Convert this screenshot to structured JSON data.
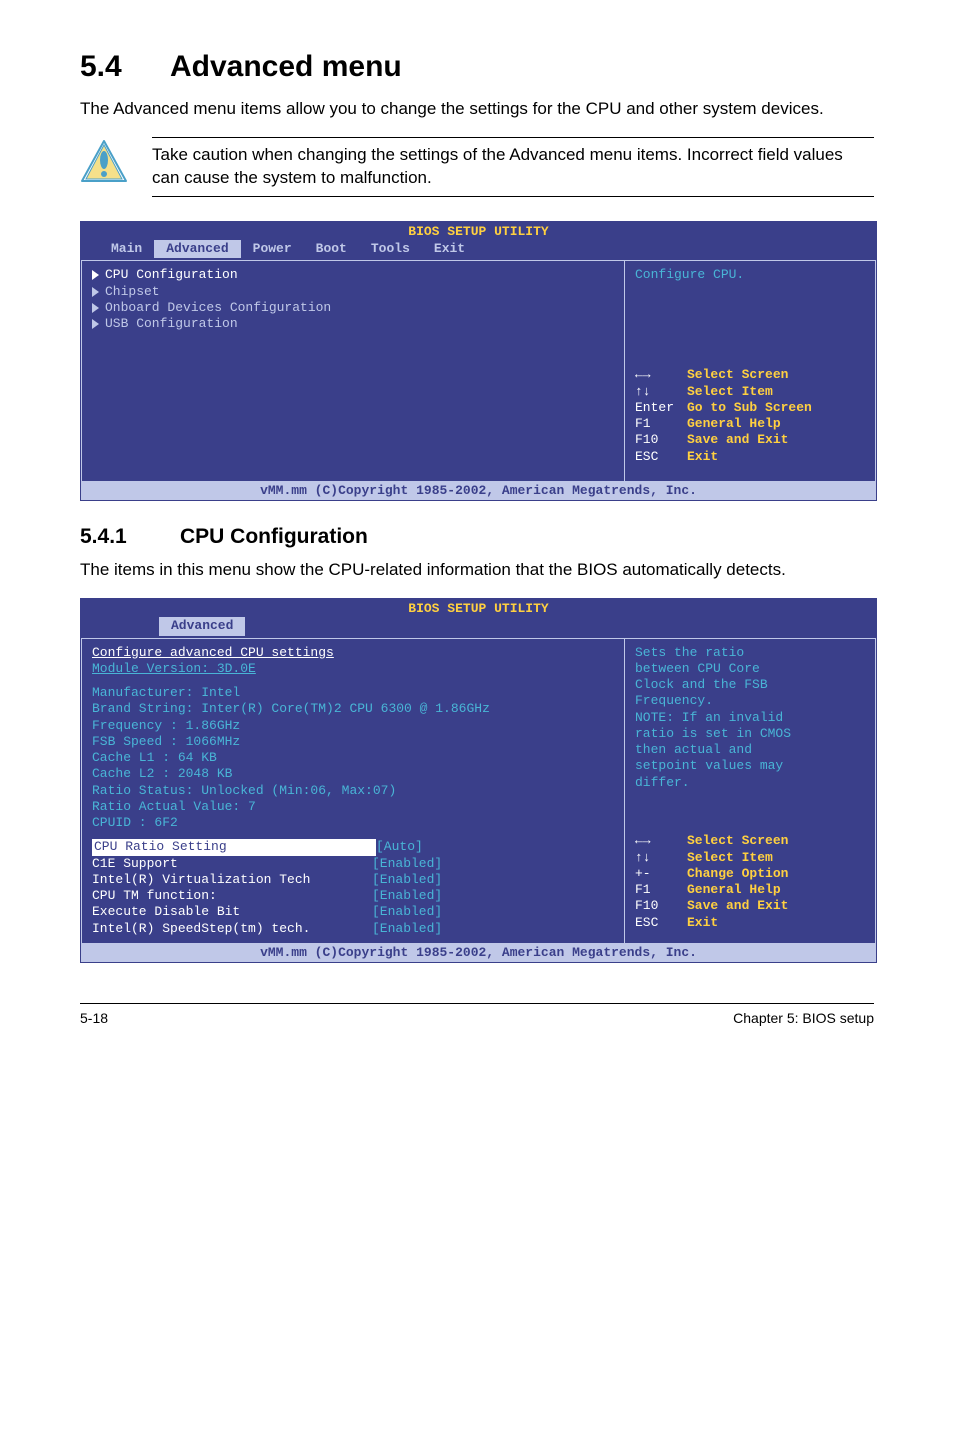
{
  "section": {
    "number": "5.4",
    "title": "Advanced menu",
    "intro": "The Advanced menu items allow you to change the settings for the CPU and other system devices.",
    "note": "Take caution when changing the settings of the Advanced menu items. Incorrect field values can cause the system to malfunction."
  },
  "bios1": {
    "title": "BIOS SETUP UTILITY",
    "tabs": [
      "Main",
      "Advanced",
      "Power",
      "Boot",
      "Tools",
      "Exit"
    ],
    "active_tab": "Advanced",
    "menu_items": [
      {
        "label": "CPU Configuration",
        "selected": true
      },
      {
        "label": "Chipset",
        "selected": false
      },
      {
        "label": "Onboard Devices Configuration",
        "selected": false
      },
      {
        "label": "USB Configuration",
        "selected": false
      }
    ],
    "help_text": "Configure CPU.",
    "keys": [
      {
        "key": "←→",
        "label": "Select Screen"
      },
      {
        "key": "↑↓",
        "label": "Select Item"
      },
      {
        "key": "Enter",
        "label": "Go to Sub Screen"
      },
      {
        "key": "F1",
        "label": "General Help"
      },
      {
        "key": "F10",
        "label": "Save and Exit"
      },
      {
        "key": "ESC",
        "label": "Exit"
      }
    ],
    "footer": "vMM.mm (C)Copyright 1985-2002, American Megatrends, Inc."
  },
  "subsection": {
    "number": "5.4.1",
    "title": "CPU Configuration",
    "intro": "The items in this menu show the CPU-related information that the BIOS automatically detects."
  },
  "bios2": {
    "title": "BIOS SETUP UTILITY",
    "active_tab": "Advanced",
    "heading": "Configure advanced CPU settings",
    "module_line": "Module Version: 3D.0E",
    "info_lines": [
      "Manufacturer: Intel",
      "Brand String: Inter(R) Core(TM)2 CPU 6300 @ 1.86GHz",
      "Frequency   : 1.86GHz",
      "FSB Speed   : 1066MHz",
      "Cache L1    : 64 KB",
      "Cache L2    : 2048 KB",
      "Ratio Status: Unlocked (Min:06, Max:07)",
      "Ratio Actual Value: 7",
      "CPUID       : 6F2"
    ],
    "options": [
      {
        "label": "CPU Ratio Setting",
        "value": "[Auto]",
        "selected": true
      },
      {
        "label": "C1E Support",
        "value": "[Enabled]",
        "selected": false
      },
      {
        "label": "Intel(R) Virtualization Tech",
        "value": "[Enabled]",
        "selected": false
      },
      {
        "label": "CPU TM function:",
        "value": "[Enabled]",
        "selected": false
      },
      {
        "label": "Execute Disable Bit",
        "value": "[Enabled]",
        "selected": false
      },
      {
        "label": "Intel(R) SpeedStep(tm) tech.",
        "value": "[Enabled]",
        "selected": false
      }
    ],
    "help_lines": [
      "Sets the ratio",
      "between CPU Core",
      "Clock and the FSB",
      "Frequency.",
      "NOTE: If an invalid",
      "ratio is set in CMOS",
      "then actual and",
      "setpoint values may",
      "differ."
    ],
    "keys": [
      {
        "key": "←→",
        "label": "Select Screen"
      },
      {
        "key": "↑↓",
        "label": "Select Item"
      },
      {
        "key": "+-",
        "label": "Change Option"
      },
      {
        "key": "F1",
        "label": "General Help"
      },
      {
        "key": "F10",
        "label": "Save and Exit"
      },
      {
        "key": "ESC",
        "label": "Exit"
      }
    ],
    "footer": "vMM.mm (C)Copyright 1985-2002, American Megatrends, Inc."
  },
  "footer": {
    "left": "5-18",
    "right": "Chapter 5: BIOS setup"
  }
}
